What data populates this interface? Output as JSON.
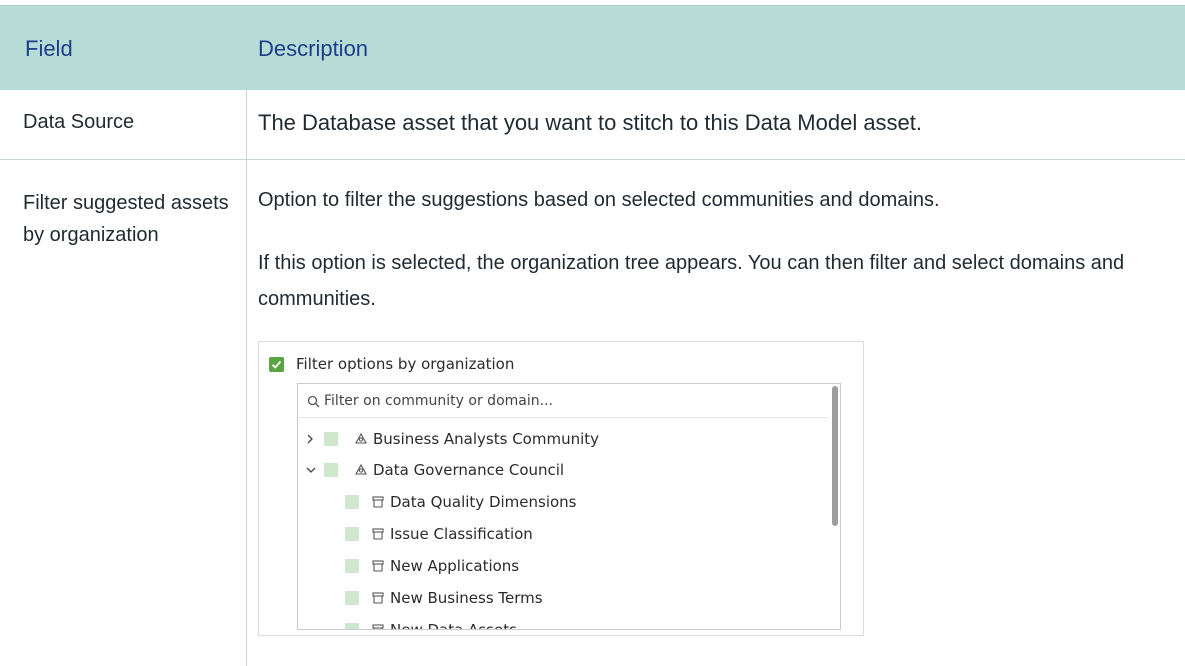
{
  "table": {
    "headers": {
      "field": "Field",
      "description": "Description"
    },
    "rows": [
      {
        "field": "Data Source",
        "description": "The Database asset that you want to stitch to this Data Model asset."
      },
      {
        "field": "Filter suggested assets by organization",
        "description_p1": "Option to filter the suggestions based on selected communities and domains.",
        "description_p2": "If this option is selected, the organization tree appears. You can then filter and select domains and communities."
      }
    ]
  },
  "panel": {
    "checkbox_label": "Filter options by organization",
    "checkbox_checked": true,
    "search": {
      "value": "",
      "placeholder": "Filter on community or domain..."
    },
    "tree": [
      {
        "label": "Business Analysts Community",
        "type": "community",
        "expanded": false,
        "icon": "community-icon"
      },
      {
        "label": "Data Governance Council",
        "type": "community",
        "expanded": true,
        "icon": "community-icon"
      },
      {
        "label": "Data Quality Dimensions",
        "type": "domain",
        "icon": "domain-icon"
      },
      {
        "label": "Issue Classification",
        "type": "domain",
        "icon": "domain-icon"
      },
      {
        "label": "New Applications",
        "type": "domain",
        "icon": "domain-icon"
      },
      {
        "label": "New Business Terms",
        "type": "domain",
        "icon": "domain-icon"
      },
      {
        "label": "New Data Assets",
        "type": "domain",
        "icon": "domain-icon"
      }
    ]
  },
  "colors": {
    "header_bg": "#b7dbd5",
    "header_text": "#1d3e8a",
    "checkbox": "#5aa442",
    "tree_square": "#cfe8cd"
  }
}
